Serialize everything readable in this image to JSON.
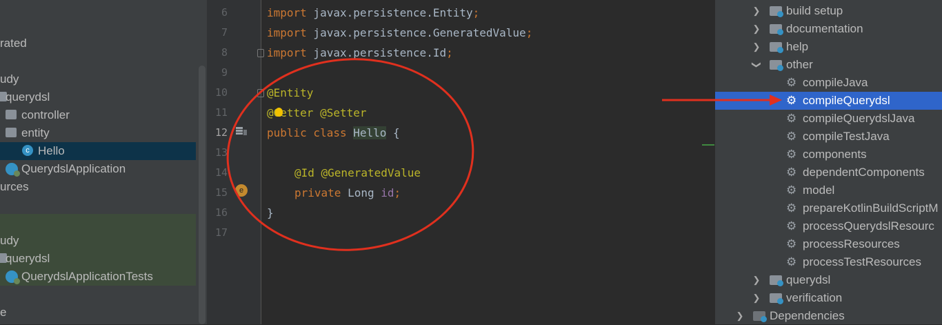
{
  "project_tree": {
    "rows": [
      {
        "text": "rated"
      },
      {
        "text": "udy"
      },
      {
        "text": "querydsl"
      },
      {
        "text": "controller"
      },
      {
        "text": "entity"
      },
      {
        "text": "Hello"
      },
      {
        "text": "QuerydslApplication"
      },
      {
        "text": "urces"
      },
      {
        "text": "udy"
      },
      {
        "text": "querydsl"
      },
      {
        "text": "QuerydslApplicationTests"
      },
      {
        "text": "e"
      }
    ]
  },
  "editor": {
    "line_numbers": [
      "6",
      "7",
      "8",
      "9",
      "10",
      "11",
      "12",
      "13",
      "14",
      "15",
      "16",
      "17"
    ],
    "active_line": "12",
    "code": {
      "l6_kw": "import",
      "l6_rest": " javax.persistence.Entity",
      "l6_semi": ";",
      "l7_kw": "import",
      "l7_rest": " javax.persistence.GeneratedValue",
      "l7_semi": ";",
      "l8_kw": "import",
      "l8_rest": " javax.persistence.Id",
      "l8_semi": ";",
      "l10_ann": "@Entity",
      "l11_ann1": "@Getter",
      "l11_ann2": "@Setter",
      "l12_kw": "public class",
      "l12_cls": "Hello",
      "l12_rest": " {",
      "l14_ann": "@Id @GeneratedValue",
      "l15_kw": "private",
      "l15_type": " Long ",
      "l15_fld": "id",
      "l15_semi": ";",
      "l16": "}"
    },
    "bean_icon_label": "e"
  },
  "gradle_tree": {
    "groups_top": [
      "build setup",
      "documentation",
      "help",
      "other"
    ],
    "other_tasks": [
      "compileJava",
      "compileQuerydsl",
      "compileQuerydslJava",
      "compileTestJava",
      "components",
      "dependentComponents",
      "model",
      "prepareKotlinBuildScriptM",
      "processQuerydslResourc",
      "processResources",
      "processTestResources"
    ],
    "selected_task": "compileQuerydsl",
    "groups_bottom": [
      "querydsl",
      "verification"
    ],
    "dependencies_label": "Dependencies"
  },
  "annotation_colors": {
    "circle": "#e0301e",
    "arrow": "#e0301e"
  }
}
